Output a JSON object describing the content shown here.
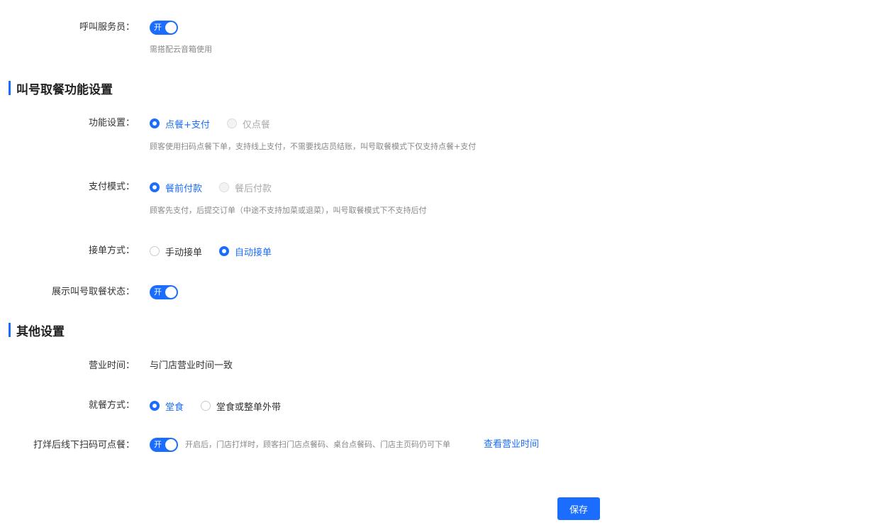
{
  "call_waiter": {
    "label": "呼叫服务员：",
    "switch_text": "开",
    "hint": "需搭配云音箱使用"
  },
  "section_call": {
    "title": "叫号取餐功能设置"
  },
  "function_setting": {
    "label": "功能设置：",
    "options": [
      "点餐+支付",
      "仅点餐"
    ],
    "hint": "顾客使用扫码点餐下单，支持线上支付，不需要找店员结账，叫号取餐模式下仅支持点餐+支付"
  },
  "pay_mode": {
    "label": "支付模式：",
    "options": [
      "餐前付款",
      "餐后付款"
    ],
    "hint": "顾客先支付，后提交订单（中途不支持加菜或退菜），叫号取餐模式下不支持后付"
  },
  "accept_mode": {
    "label": "接单方式：",
    "options": [
      "手动接单",
      "自动接单"
    ]
  },
  "show_call_status": {
    "label": "展示叫号取餐状态：",
    "switch_text": "开"
  },
  "section_other": {
    "title": "其他设置"
  },
  "business_hours": {
    "label": "营业时间：",
    "value": "与门店营业时间一致"
  },
  "dining_mode": {
    "label": "就餐方式：",
    "options": [
      "堂食",
      "堂食或整单外带"
    ]
  },
  "offline_scan": {
    "label": "打烊后线下扫码可点餐：",
    "switch_text": "开",
    "hint": "开启后，门店打烊时，顾客扫门店点餐码、桌台点餐码、门店主页码仍可下单",
    "link": "查看营业时间"
  },
  "save_label": "保存",
  "colors": {
    "accent": "#1a6dff"
  }
}
